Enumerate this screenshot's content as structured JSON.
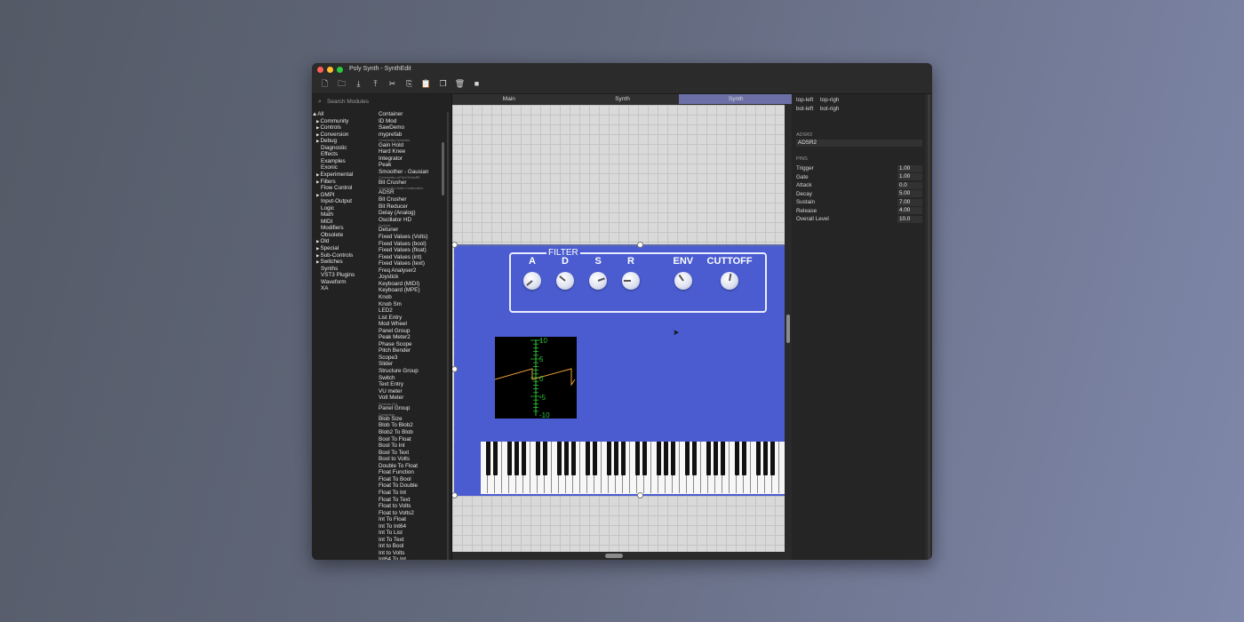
{
  "window": {
    "title": "Poly Synth - SynthEdit",
    "traffic_colors": [
      "#ff5f57",
      "#febc2e",
      "#28c840"
    ]
  },
  "toolbar": [
    "new-file-icon",
    "open-folder-icon",
    "import-icon",
    "export-icon",
    "cut-icon",
    "copy-icon",
    "paste-icon",
    "duplicate-icon",
    "delete-icon",
    "stop-icon"
  ],
  "sidebar": {
    "search_placeholder": "Search Modules",
    "tree": [
      {
        "label": "▲All",
        "arrow": false,
        "indent": 0
      },
      {
        "label": "Community",
        "arrow": true
      },
      {
        "label": "Controls",
        "arrow": true
      },
      {
        "label": "Conversion",
        "arrow": true
      },
      {
        "label": "Debug",
        "arrow": true
      },
      {
        "label": "Diagnostic",
        "arrow": false
      },
      {
        "label": "Effects",
        "arrow": false
      },
      {
        "label": "Examples",
        "arrow": false
      },
      {
        "label": "Exonic",
        "arrow": false
      },
      {
        "label": "Experimental",
        "arrow": true
      },
      {
        "label": "Filters",
        "arrow": true
      },
      {
        "label": "Flow Control",
        "arrow": false
      },
      {
        "label": "GMPI",
        "arrow": true
      },
      {
        "label": "Input-Output",
        "arrow": false
      },
      {
        "label": "Logic",
        "arrow": false
      },
      {
        "label": "Math",
        "arrow": false
      },
      {
        "label": "MIDI",
        "arrow": false
      },
      {
        "label": "Modifiers",
        "arrow": false
      },
      {
        "label": "Obsolete",
        "arrow": false
      },
      {
        "label": "Old",
        "arrow": true
      },
      {
        "label": "Special",
        "arrow": true
      },
      {
        "label": "Sub-Controls",
        "arrow": true
      },
      {
        "label": "Switches",
        "arrow": true
      },
      {
        "label": "Synths",
        "arrow": false
      },
      {
        "label": "VST3 Plugins",
        "arrow": false
      },
      {
        "label": "Waveform",
        "arrow": false
      },
      {
        "label": "XA",
        "arrow": false
      }
    ],
    "modules": [
      {
        "label": "Container"
      },
      {
        "label": "ID Mod"
      },
      {
        "label": "SawDemo"
      },
      {
        "label": "myprefab"
      },
      {
        "label": "Community-Dynamics",
        "sub": true
      },
      {
        "label": "Gain Hold"
      },
      {
        "label": "Hard Knee"
      },
      {
        "label": "Integrator"
      },
      {
        "label": "Peak"
      },
      {
        "label": "Smoother - Gausian"
      },
      {
        "label": "Community-LeFt4eCrDstoRE",
        "sub": true
      },
      {
        "label": "Bit Crusher"
      },
      {
        "label": "Community-Under Construction",
        "sub": true
      },
      {
        "label": "ADSR"
      },
      {
        "label": "Bit Crusher"
      },
      {
        "label": "Bit Reducer"
      },
      {
        "label": "Delay (Analog)"
      },
      {
        "label": "Oscillator HD"
      },
      {
        "label": "Controls",
        "sub": true
      },
      {
        "label": "Detuner"
      },
      {
        "label": "Fixed Values (Volts)"
      },
      {
        "label": "Fixed Values (bool)"
      },
      {
        "label": "Fixed Values (float)"
      },
      {
        "label": "Fixed Values (int)"
      },
      {
        "label": "Fixed Values (text)"
      },
      {
        "label": "Freq Analyser2"
      },
      {
        "label": "Joystick"
      },
      {
        "label": "Keyboard (MIDI)"
      },
      {
        "label": "Keyboard (MPE)"
      },
      {
        "label": "Knob"
      },
      {
        "label": "Knob Sm"
      },
      {
        "label": "LED2"
      },
      {
        "label": "List Entry"
      },
      {
        "label": "Mod Wheel"
      },
      {
        "label": "Panel Group"
      },
      {
        "label": "Peak Meter2"
      },
      {
        "label": "Phase Scope"
      },
      {
        "label": "Pitch Bender"
      },
      {
        "label": "Scope3"
      },
      {
        "label": "Slider"
      },
      {
        "label": "Structure Group"
      },
      {
        "label": "Switch"
      },
      {
        "label": "Text Entry"
      },
      {
        "label": "VU meter"
      },
      {
        "label": "Volt Meter"
      },
      {
        "label": "Controls-GUI",
        "sub": true
      },
      {
        "label": "Panel Group"
      },
      {
        "label": "Conversion",
        "sub": true
      },
      {
        "label": "Blob Size"
      },
      {
        "label": "Blob To Blob2"
      },
      {
        "label": "Blob2 To Blob"
      },
      {
        "label": "Bool To Float"
      },
      {
        "label": "Bool To Int"
      },
      {
        "label": "Bool To Text"
      },
      {
        "label": "Bool to Volts"
      },
      {
        "label": "Double To Float"
      },
      {
        "label": "Float Function"
      },
      {
        "label": "Float To Bool"
      },
      {
        "label": "Float To Double"
      },
      {
        "label": "Float To Int"
      },
      {
        "label": "Float To Text"
      },
      {
        "label": "Float to Volts"
      },
      {
        "label": "Float to Volts2"
      },
      {
        "label": "Int To Float"
      },
      {
        "label": "Int To Int64"
      },
      {
        "label": "Int To List"
      },
      {
        "label": "Int To Text"
      },
      {
        "label": "Int to Bool"
      },
      {
        "label": "Int to Volts"
      },
      {
        "label": "Int64 To Int"
      }
    ]
  },
  "tabs": [
    {
      "label": "Main",
      "active": false
    },
    {
      "label": "Synth",
      "active": false
    },
    {
      "label": "Synth",
      "active": true
    }
  ],
  "synth_panel": {
    "filter_label": "FILTER",
    "knobs": [
      {
        "label": "A",
        "angle": -130
      },
      {
        "label": "D",
        "angle": -50
      },
      {
        "label": "S",
        "angle": 70
      },
      {
        "label": "R",
        "angle": -90
      },
      {
        "label": "ENV",
        "angle": -35
      },
      {
        "label": "CUTTOFF",
        "angle": 10
      }
    ],
    "scope": {
      "ticks": [
        "10",
        "5",
        "0",
        "-5",
        "-10"
      ]
    }
  },
  "inspector": {
    "align": [
      "top-left",
      "top-righ",
      "bot-left",
      "bot-righ"
    ],
    "module_type": "ADSR2",
    "module_name": "ADSR2",
    "pins_header": "PINS",
    "pins": [
      {
        "name": "Trigger",
        "value": "1.00"
      },
      {
        "name": "Gate",
        "value": "1.00"
      },
      {
        "name": "Attack",
        "value": "0.0"
      },
      {
        "name": "Decay",
        "value": "5.00"
      },
      {
        "name": "Sustain",
        "value": "7.00"
      },
      {
        "name": "Release",
        "value": "4.00"
      },
      {
        "name": "Overall Level",
        "value": "10.0"
      }
    ]
  },
  "colors": {
    "panel": "#4a5ccf",
    "active_tab": "#6b6fa6"
  }
}
